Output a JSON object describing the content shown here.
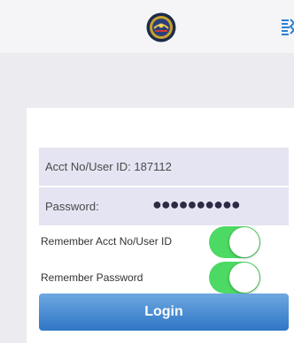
{
  "header": {
    "logo_icon": "seal-logo-icon",
    "corner_icon": "app-icon-partial"
  },
  "form": {
    "acct_label": "Acct No/User ID:",
    "acct_value": "187112",
    "password_label": "Password:",
    "password_value": "●●●●●●●●●●"
  },
  "toggles": {
    "remember_acct_label": "Remember Acct No/User ID",
    "remember_acct_on": true,
    "remember_password_label": "Remember Password",
    "remember_password_on": true,
    "on_color": "#4cd964"
  },
  "login": {
    "label": "Login",
    "color": "#3b82cf"
  }
}
